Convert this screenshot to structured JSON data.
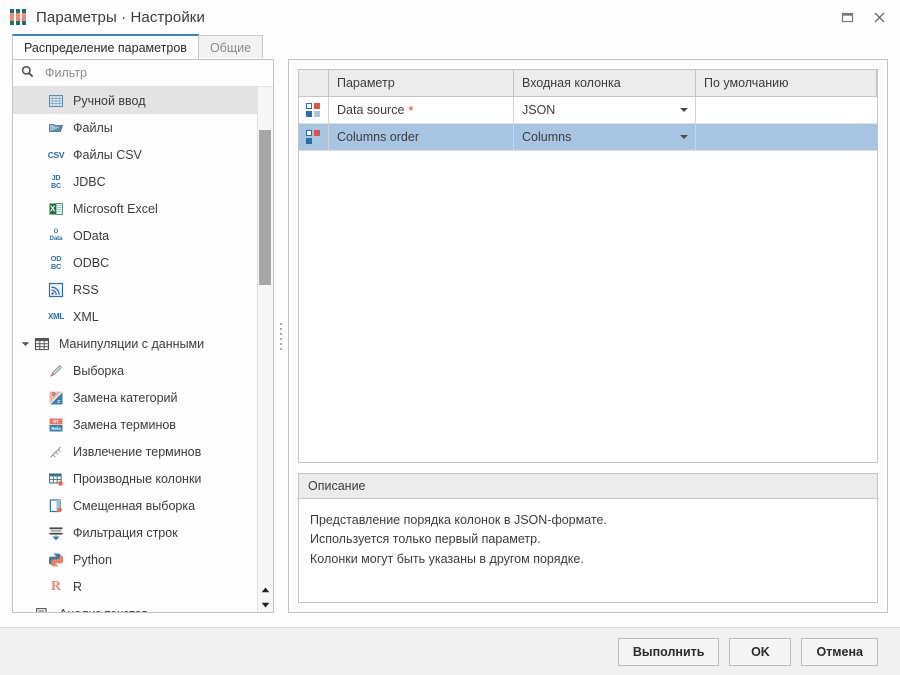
{
  "window": {
    "title": "Параметры · Настройки",
    "app_icon": "bars-icon",
    "controls": {
      "maximize": "maximize-icon",
      "close": "close-icon"
    }
  },
  "tabs": [
    {
      "label": "Распределение параметров",
      "active": true
    },
    {
      "label": "Общие",
      "active": false
    }
  ],
  "sidebar": {
    "filter": {
      "placeholder": "Фильтр",
      "value": "",
      "icon": "search-icon"
    },
    "items": [
      {
        "label": "Ручной ввод",
        "icon": "grid-table-icon",
        "level": 1,
        "selected": true
      },
      {
        "label": "Файлы",
        "icon": "folder-open-icon",
        "level": 1,
        "selected": false
      },
      {
        "label": "Файлы CSV",
        "icon": "csv-icon",
        "level": 1,
        "selected": false
      },
      {
        "label": "JDBC",
        "icon": "jdbc-icon",
        "level": 1,
        "selected": false
      },
      {
        "label": "Microsoft Excel",
        "icon": "excel-icon",
        "level": 1,
        "selected": false
      },
      {
        "label": "OData",
        "icon": "odata-icon",
        "level": 1,
        "selected": false
      },
      {
        "label": "ODBC",
        "icon": "odbc-icon",
        "level": 1,
        "selected": false
      },
      {
        "label": "RSS",
        "icon": "rss-icon",
        "level": 1,
        "selected": false
      },
      {
        "label": "XML",
        "icon": "xml-icon",
        "level": 1,
        "selected": false
      },
      {
        "label": "Манипуляции с данными",
        "icon": "table-group-icon",
        "level": 0,
        "selected": false,
        "expanded": true
      },
      {
        "label": "Выборка",
        "icon": "pen-icon",
        "level": 1,
        "selected": false
      },
      {
        "label": "Замена категорий",
        "icon": "replace-category-icon",
        "level": 1,
        "selected": false
      },
      {
        "label": "Замена терминов",
        "icon": "replace-terms-icon",
        "level": 1,
        "selected": false
      },
      {
        "label": "Извлечение терминов",
        "icon": "extract-terms-icon",
        "level": 1,
        "selected": false
      },
      {
        "label": "Производные колонки",
        "icon": "derived-columns-icon",
        "level": 1,
        "selected": false
      },
      {
        "label": "Смещенная выборка",
        "icon": "biased-sample-icon",
        "level": 1,
        "selected": false
      },
      {
        "label": "Фильтрация строк",
        "icon": "filter-rows-icon",
        "level": 1,
        "selected": false
      },
      {
        "label": "Python",
        "icon": "python-icon",
        "level": 1,
        "selected": false
      },
      {
        "label": "R",
        "icon": "r-icon",
        "level": 1,
        "selected": false
      },
      {
        "label": "Анализ текстов",
        "icon": "text-analysis-icon",
        "level": 0,
        "selected": false,
        "expanded": true
      }
    ]
  },
  "params_table": {
    "columns": [
      "",
      "Параметр",
      "Входная колонка",
      "По умолчанию"
    ],
    "rows": [
      {
        "icon": "param-grid-icon",
        "name": "Data source",
        "required": "*",
        "input_column": "JSON",
        "default": "",
        "selected": false
      },
      {
        "icon": "param-grid-icon",
        "name": "Columns order",
        "required": "",
        "input_column": "Columns",
        "default": "",
        "selected": true
      }
    ]
  },
  "description": {
    "header": "Описание",
    "lines": [
      "Представление порядка колонок в JSON-формате.",
      "Используется только первый параметр.",
      "Колонки могут быть указаны в другом порядке."
    ]
  },
  "footer": {
    "execute_label": "Выполнить",
    "ok_label": "OK",
    "cancel_label": "Отмена"
  },
  "colors": {
    "accent": "#3f7fbf",
    "selection": "#a7c5e0",
    "required": "#e03a2f",
    "header_bg": "#ececec"
  }
}
